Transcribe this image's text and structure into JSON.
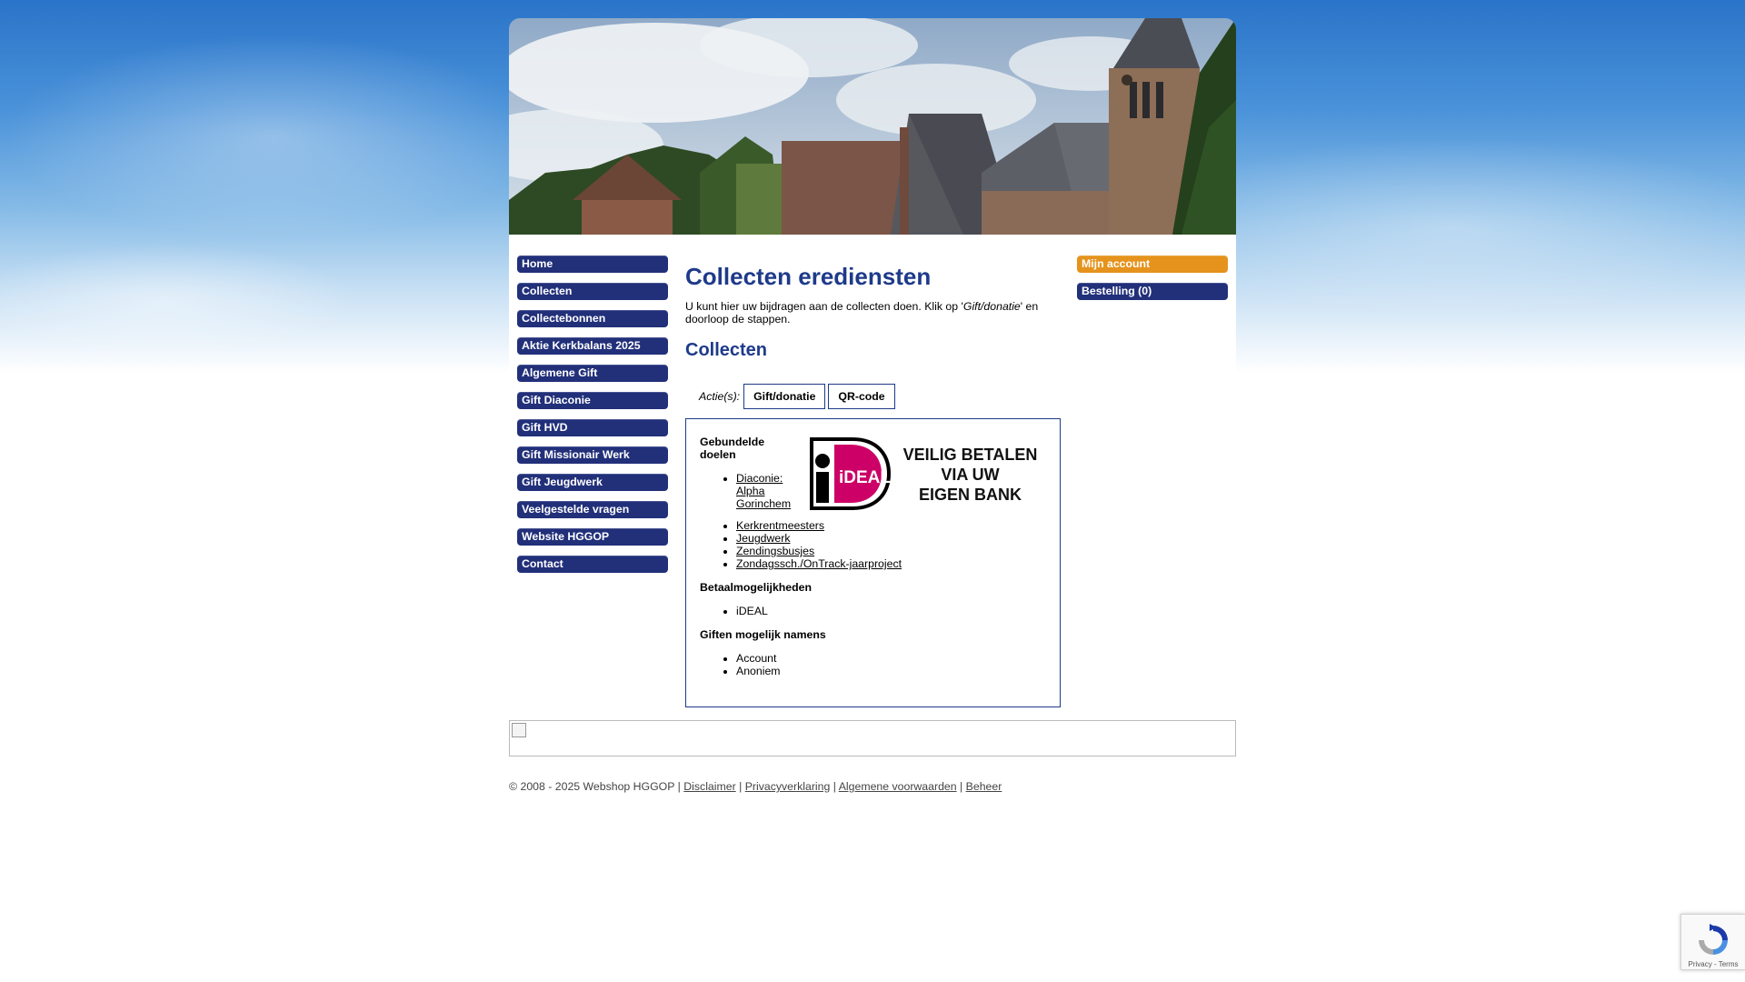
{
  "nav": {
    "left": [
      "Home",
      "Collecten",
      "Collectebonnen",
      "Aktie Kerkbalans 2025",
      "Algemene Gift",
      "Gift Diaconie",
      "Gift HVD",
      "Gift Missionair Werk",
      "Gift Jeugdwerk",
      "Veelgestelde vragen",
      "Website HGGOP",
      "Contact"
    ],
    "right": [
      "Mijn account",
      "Bestelling (0)"
    ]
  },
  "page": {
    "title": "Collecten erediensten",
    "intro_before": "U kunt hier uw bijdragen aan de collecten doen. Klik op '",
    "intro_em": "Gift/donatie",
    "intro_after": "' en doorloop de stappen.",
    "section_title": "Collecten",
    "actions_label": "Actie(s):",
    "actions": [
      "Gift/donatie",
      "QR-code"
    ]
  },
  "box": {
    "goals_title": "Gebundelde doelen",
    "goals": [
      "Diaconie: Alpha Gorinchem",
      "Kerkrentmeesters",
      "Jeugdwerk",
      "Zendingsbusjes",
      "Zondagssch./OnTrack-jaarproject"
    ],
    "payment_title": "Betaalmogelijkheden",
    "payment": [
      "iDEAL"
    ],
    "gifts_title": "Giften mogelijk namens",
    "gifts": [
      "Account",
      "Anoniem"
    ],
    "ideal_logo": "iDEAL",
    "ideal_text": [
      "VEILIG BETALEN",
      "VIA UW",
      "EIGEN BANK"
    ]
  },
  "footer": {
    "copyright": "© 2008 - 2025 Webshop HGGOP",
    "sep": "|",
    "links": [
      "Disclaimer",
      "Privacyverklaring",
      "Algemene voorwaarden",
      "Beheer"
    ]
  },
  "recaptcha": {
    "links": "Privacy - Terms"
  },
  "colors": {
    "nav_bg": "#22307a",
    "account_bg": "#e5931d",
    "heading": "#1e3a8a"
  }
}
